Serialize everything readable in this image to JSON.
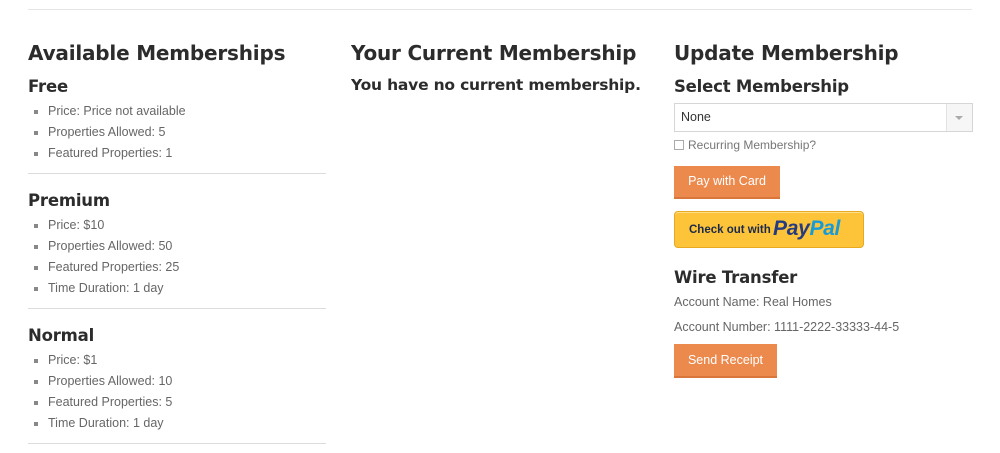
{
  "available": {
    "heading": "Available Memberships",
    "plans": [
      {
        "name": "Free",
        "details": [
          "Price: Price not available",
          "Properties Allowed: 5",
          "Featured Properties: 1"
        ]
      },
      {
        "name": "Premium",
        "details": [
          "Price: $10",
          "Properties Allowed: 50",
          "Featured Properties: 25",
          "Time Duration: 1 day"
        ]
      },
      {
        "name": "Normal",
        "details": [
          "Price: $1",
          "Properties Allowed: 10",
          "Featured Properties: 5",
          "Time Duration: 1 day"
        ]
      }
    ]
  },
  "current": {
    "heading": "Your Current Membership",
    "message": "You have no current membership."
  },
  "update": {
    "heading": "Update Membership",
    "select_label": "Select Membership",
    "select_value": "None",
    "recurring_label": "Recurring Membership?",
    "recurring_checked": false,
    "pay_card_label": "Pay with Card",
    "paypal": {
      "prefix": "Check out with",
      "logo_pay": "Pay",
      "logo_pal": "Pal"
    },
    "wire": {
      "heading": "Wire Transfer",
      "account_name": "Account Name: Real Homes",
      "account_number": "Account Number: 1111-2222-33333-44-5"
    },
    "send_receipt_label": "Send Receipt"
  },
  "colors": {
    "accent": "#ec894d",
    "paypal_yellow": "#fdc43a",
    "paypal_dark": "#253b80",
    "paypal_light": "#179bd7"
  }
}
